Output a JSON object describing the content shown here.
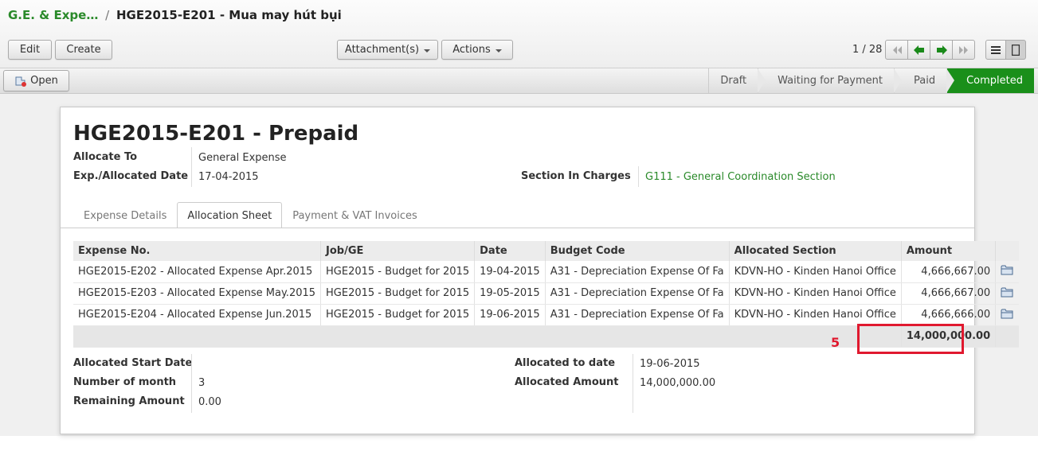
{
  "breadcrumb": {
    "parent": "G.E. & Expe…",
    "separator": "/",
    "title": "HGE2015-E201 - Mua may hút bụi"
  },
  "toolbar": {
    "edit": "Edit",
    "create": "Create",
    "attachments": "Attachment(s)",
    "actions": "Actions"
  },
  "pager": {
    "text": "1 / 28"
  },
  "statusbar": {
    "open_label": "Open",
    "stages": [
      {
        "label": "Draft",
        "active": false
      },
      {
        "label": "Waiting for Payment",
        "active": false
      },
      {
        "label": "Paid",
        "active": false
      },
      {
        "label": "Completed",
        "active": true
      }
    ]
  },
  "form": {
    "title": "HGE2015-E201 -  Prepaid",
    "allocate_to_label": "Allocate To",
    "allocate_to_value": "General Expense",
    "date_label": "Exp./Allocated Date",
    "date_value": "17-04-2015",
    "section_label": "Section In Charges",
    "section_value": "G111 - General Coordination Section"
  },
  "tabs": [
    {
      "label": "Expense Details",
      "active": false
    },
    {
      "label": "Allocation Sheet",
      "active": true
    },
    {
      "label": "Payment & VAT Invoices",
      "active": false
    }
  ],
  "grid": {
    "columns": [
      "Expense No.",
      "Job/GE",
      "Date",
      "Budget Code",
      "Allocated Section",
      "Amount"
    ],
    "rows": [
      [
        "HGE2015-E202 - Allocated Expense Apr.2015",
        "HGE2015 - Budget for 2015",
        "19-04-2015",
        "A31 - Depreciation Expense Of Fa",
        "KDVN-HO - Kinden Hanoi Office",
        "4,666,667.00"
      ],
      [
        "HGE2015-E203 - Allocated Expense May.2015",
        "HGE2015 - Budget for 2015",
        "19-05-2015",
        "A31 - Depreciation Expense Of Fa",
        "KDVN-HO - Kinden Hanoi Office",
        "4,666,667.00"
      ],
      [
        "HGE2015-E204 - Allocated Expense Jun.2015",
        "HGE2015 - Budget for 2015",
        "19-06-2015",
        "A31 - Depreciation Expense Of Fa",
        "KDVN-HO - Kinden Hanoi Office",
        "4,666,666.00"
      ]
    ],
    "total": "14,000,000.00"
  },
  "summary": {
    "start_date_label": "Allocated Start Date",
    "start_date_value": "",
    "months_label": "Number of month",
    "months_value": "3",
    "remaining_label": "Remaining Amount",
    "remaining_value": "0.00",
    "to_date_label": "Allocated to date",
    "to_date_value": "19-06-2015",
    "amount_label": "Allocated Amount",
    "amount_value": "14,000,000.00"
  },
  "annotation": {
    "number": "5"
  },
  "colors": {
    "accent_green": "#1a8f1a",
    "link_green": "#2a8a2a",
    "callout_red": "#e0192f"
  }
}
